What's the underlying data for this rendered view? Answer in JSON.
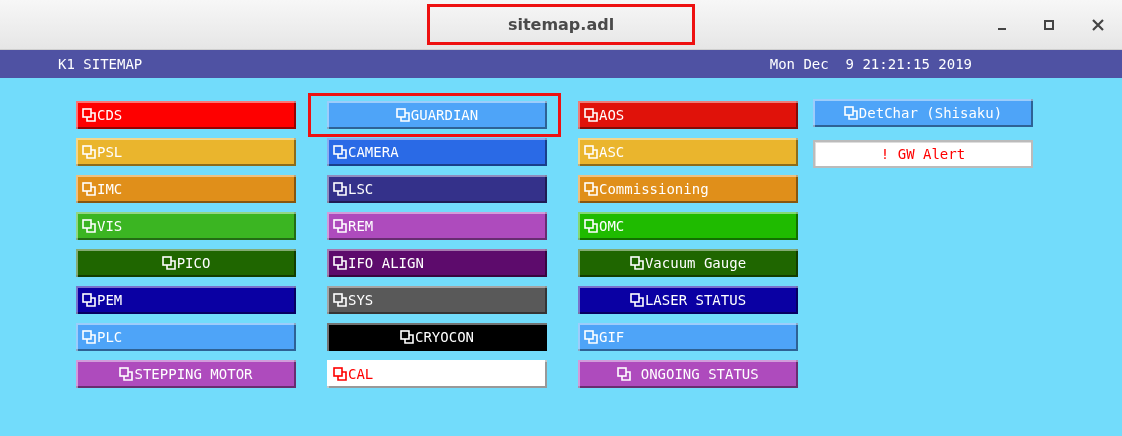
{
  "window": {
    "title": "sitemap.adl",
    "title_highlighted": true
  },
  "header": {
    "title": "K1 SITEMAP",
    "timestamp": "Mon Dec  9 21:21:15 2019"
  },
  "columns": [
    {
      "buttons": [
        {
          "kind": "related",
          "label": "CDS",
          "color": "#fe0000",
          "warning": false,
          "centered": false,
          "highlighted": false
        },
        {
          "kind": "related",
          "label": "PSL",
          "color": "#eab52d",
          "warning": false,
          "centered": false,
          "highlighted": false
        },
        {
          "kind": "related",
          "label": "IMC",
          "color": "#e08f1a",
          "warning": false,
          "centered": false,
          "highlighted": false
        },
        {
          "kind": "related",
          "label": "VIS",
          "color": "#3bb522",
          "warning": false,
          "centered": false,
          "highlighted": false
        },
        {
          "kind": "related",
          "label": "PICO",
          "color": "#1f6600",
          "warning": false,
          "centered": true,
          "highlighted": false
        },
        {
          "kind": "related",
          "label": "PEM",
          "color": "#0a00a3",
          "warning": false,
          "centered": false,
          "highlighted": false
        },
        {
          "kind": "related",
          "label": "PLC",
          "color": "#4ea4f8",
          "warning": false,
          "centered": false,
          "highlighted": false
        },
        {
          "kind": "related",
          "label": "STEPPING MOTOR",
          "color": "#ae4bbd",
          "warning": false,
          "centered": true,
          "highlighted": false
        }
      ]
    },
    {
      "buttons": [
        {
          "kind": "related",
          "label": "GUARDIAN",
          "color": "#4ea4f8",
          "warning": false,
          "centered": true,
          "highlighted": true
        },
        {
          "kind": "related",
          "label": "CAMERA",
          "color": "#2a6ae6",
          "warning": false,
          "centered": false,
          "highlighted": false
        },
        {
          "kind": "related",
          "label": "LSC",
          "color": "#34318a",
          "warning": false,
          "centered": false,
          "highlighted": false
        },
        {
          "kind": "related",
          "label": "REM",
          "color": "#ae4bbd",
          "warning": false,
          "centered": false,
          "highlighted": false
        },
        {
          "kind": "related",
          "label": "IFO ALIGN",
          "color": "#5d0b6c",
          "warning": false,
          "centered": false,
          "highlighted": false
        },
        {
          "kind": "related",
          "label": "SYS",
          "color": "#595959",
          "warning": false,
          "centered": false,
          "highlighted": false
        },
        {
          "kind": "related",
          "label": "CRYOCON",
          "color": "#000000",
          "warning": false,
          "centered": true,
          "highlighted": false
        },
        {
          "kind": "related",
          "label": "CAL",
          "color": "#ffffff",
          "warning": true,
          "centered": false,
          "highlighted": false
        }
      ]
    },
    {
      "buttons": [
        {
          "kind": "related",
          "label": "AOS",
          "color": "#e0120a",
          "warning": false,
          "centered": false,
          "highlighted": false
        },
        {
          "kind": "related",
          "label": "ASC",
          "color": "#eab52d",
          "warning": false,
          "centered": false,
          "highlighted": false
        },
        {
          "kind": "related",
          "label": "Commissioning",
          "color": "#e08f1a",
          "warning": false,
          "centered": false,
          "highlighted": false
        },
        {
          "kind": "related",
          "label": "OMC",
          "color": "#1fbb00",
          "warning": false,
          "centered": false,
          "highlighted": false
        },
        {
          "kind": "related",
          "label": "Vacuum Gauge",
          "color": "#1f6600",
          "warning": false,
          "centered": true,
          "highlighted": false
        },
        {
          "kind": "related",
          "label": "LASER STATUS",
          "color": "#0a00a3",
          "warning": false,
          "centered": true,
          "highlighted": false
        },
        {
          "kind": "related",
          "label": "GIF",
          "color": "#4ea4f8",
          "warning": false,
          "centered": false,
          "highlighted": false
        },
        {
          "kind": "related",
          "label": " ONGOING STATUS",
          "color": "#ae4bbd",
          "warning": false,
          "centered": true,
          "highlighted": false
        }
      ]
    },
    {
      "buttons": [
        {
          "kind": "related",
          "label": "DetChar (Shisaku)",
          "color": "#4ea4f8",
          "warning": false,
          "centered": true,
          "highlighted": false
        },
        {
          "kind": "message",
          "label": "! GW Alert",
          "color": "#ffffff",
          "warning": true,
          "centered": true,
          "highlighted": false
        }
      ]
    }
  ]
}
